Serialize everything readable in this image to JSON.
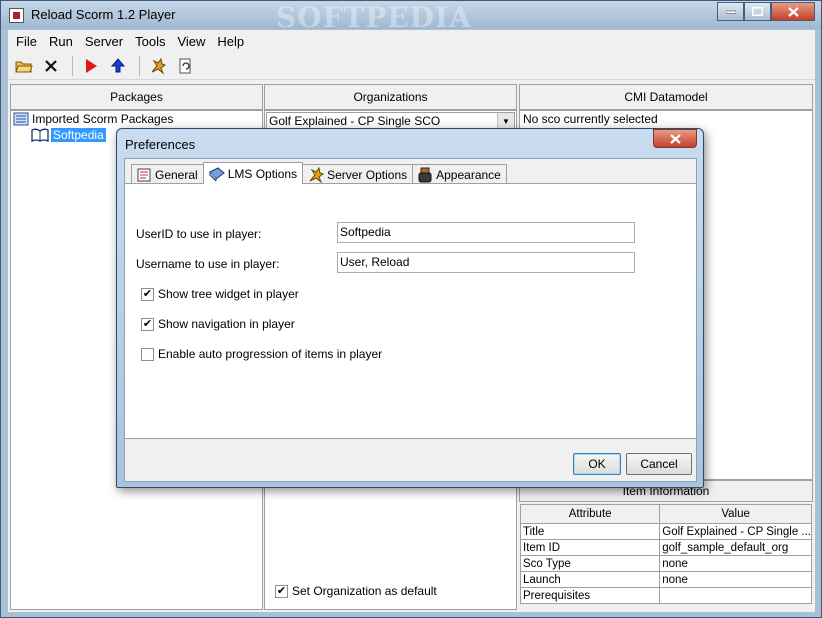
{
  "window": {
    "title": "Reload Scorm 1.2 Player",
    "watermark": "SOFTPEDIA"
  },
  "menu": [
    "File",
    "Run",
    "Server",
    "Tools",
    "View",
    "Help"
  ],
  "panels": {
    "packages": {
      "header": "Packages",
      "root": "Imported Scorm Packages",
      "child": "Softpedia"
    },
    "organizations": {
      "header": "Organizations",
      "selected": "Golf Explained - CP Single SCO",
      "default_checkbox": "Set Organization as default",
      "default_checked": true
    },
    "cmi": {
      "header": "CMI Datamodel",
      "status": "No sco currently selected"
    },
    "item_info": {
      "header": "Item Information",
      "columns": [
        "Attribute",
        "Value"
      ],
      "rows": [
        [
          "Title",
          "Golf Explained - CP Single ..."
        ],
        [
          "Item ID",
          "golf_sample_default_org"
        ],
        [
          "Sco Type",
          "none"
        ],
        [
          "Launch",
          "none"
        ],
        [
          "Prerequisites",
          ""
        ]
      ]
    }
  },
  "dialog": {
    "title": "Preferences",
    "tabs": [
      "General",
      "LMS Options",
      "Server Options",
      "Appearance"
    ],
    "active_tab": "LMS Options",
    "userid_label": "UserID to use in player:",
    "userid_value": "Softpedia",
    "username_label": "Username to use in player:",
    "username_value": "User, Reload",
    "checks": [
      {
        "label": "Show tree widget in player",
        "checked": true
      },
      {
        "label": "Show navigation in player",
        "checked": true
      },
      {
        "label": "Enable auto progression of items in player",
        "checked": false
      }
    ],
    "ok": "OK",
    "cancel": "Cancel"
  }
}
